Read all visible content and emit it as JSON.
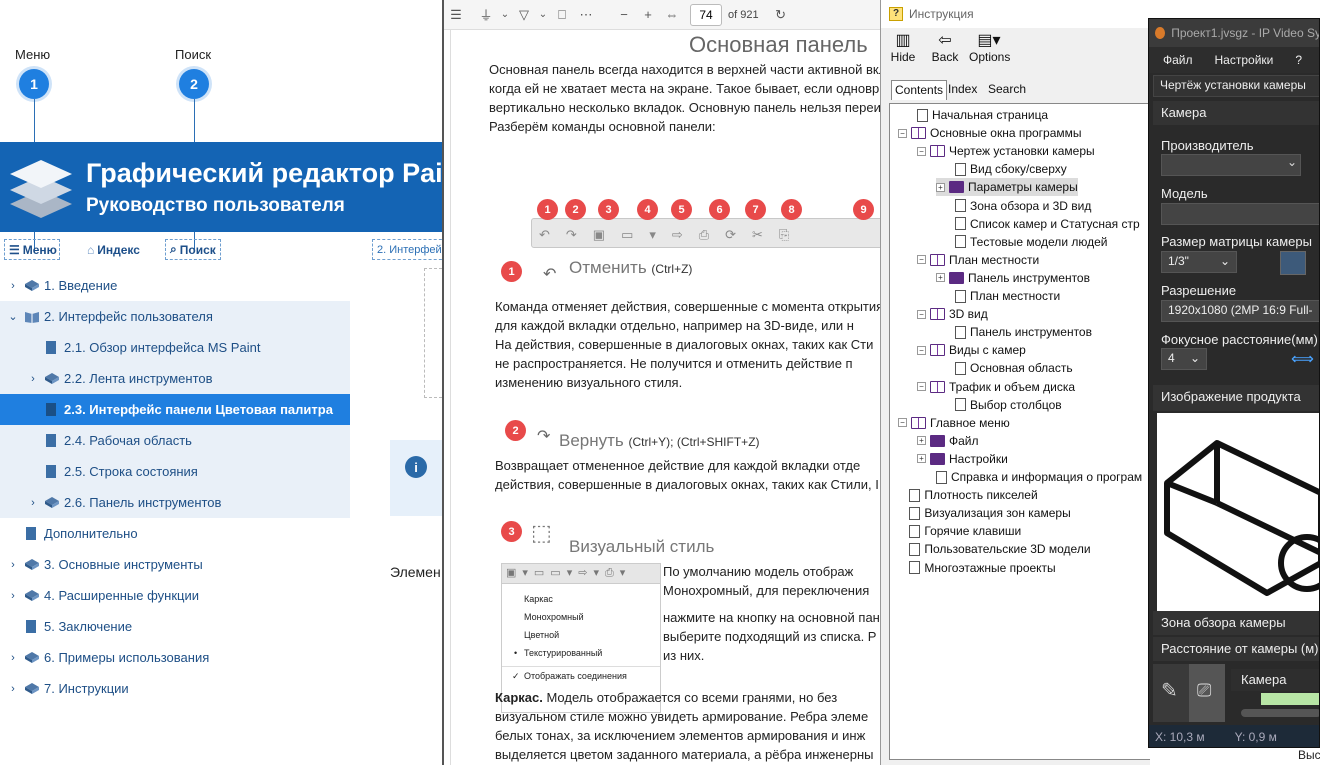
{
  "help_left": {
    "callout_menu_label": "Меню",
    "callout_menu_num": "1",
    "callout_search_label": "Поиск",
    "callout_search_num": "2",
    "banner_title": "Графический редактор Paint",
    "banner_subtitle": "Руководство пользователя",
    "toolbar": {
      "menu": "Меню",
      "index": "Индекс",
      "search": "Поиск",
      "breadcrumb": "2. Интерфей"
    },
    "tree": [
      {
        "label": "1. Введение",
        "level": 0,
        "arrow": "›",
        "icon": "book"
      },
      {
        "label": "2. Интерфейс пользователя",
        "level": 0,
        "arrow": "⌄",
        "icon": "book-open",
        "sub": true
      },
      {
        "label": "2.1. Обзор интерфейса MS Paint",
        "level": 1,
        "arrow": "",
        "icon": "page",
        "sub": true
      },
      {
        "label": "2.2. Лента инструментов",
        "level": 1,
        "arrow": "›",
        "icon": "book",
        "sub": true
      },
      {
        "label": "2.3. Интерфейс панели Цветовая палитра",
        "level": 1,
        "arrow": "",
        "icon": "page",
        "active": true
      },
      {
        "label": "2.4. Рабочая область",
        "level": 1,
        "arrow": "",
        "icon": "page",
        "sub": true
      },
      {
        "label": "2.5. Строка состояния",
        "level": 1,
        "arrow": "",
        "icon": "page",
        "sub": true
      },
      {
        "label": "2.6. Панель инструментов",
        "level": 1,
        "arrow": "›",
        "icon": "book",
        "sub": true
      },
      {
        "label": "Дополнительно",
        "level": 0,
        "arrow": "",
        "icon": "page"
      },
      {
        "label": "3. Основные инструменты",
        "level": 0,
        "arrow": "›",
        "icon": "book"
      },
      {
        "label": "4. Расширенные функции",
        "level": 0,
        "arrow": "›",
        "icon": "book"
      },
      {
        "label": "5. Заключение",
        "level": 0,
        "arrow": "",
        "icon": "page"
      },
      {
        "label": "6. Примеры использования",
        "level": 0,
        "arrow": "›",
        "icon": "book"
      },
      {
        "label": "7. Инструкции",
        "level": 0,
        "arrow": "›",
        "icon": "book"
      }
    ],
    "content_text": "Элемен"
  },
  "pdf": {
    "page_current": "74",
    "page_total": "of 921",
    "heading": "Основная панель",
    "intro": [
      "Основная панель всегда находится в верхней части активной вкл",
      "когда ей не хватает места на экране. Такое бывает, если одновр",
      "вертикально несколько вкладок. Основную панель нельзя переи",
      "Разберём команды основной панели:"
    ],
    "toolbar_badges": [
      "1",
      "2",
      "3",
      "4",
      "5",
      "6",
      "7",
      "8",
      "9"
    ],
    "sec1_num": "1",
    "sec1_title": "Отменить",
    "sec1_keys": "(Ctrl+Z)",
    "sec1_text": [
      "Команда отменяет действия, совершенные с момента открытия",
      "для каждой вкладки отдельно, например на 3D-виде, или н",
      "На действия, совершенные в диалоговых окнах, таких как Сти",
      "не распространяется. Не получится и отменить действие п",
      "изменению визуального стиля."
    ],
    "sec2_num": "2",
    "sec2_title": "Вернуть",
    "sec2_keys": "(Ctrl+Y); (Ctrl+SHIFT+Z)",
    "sec2_text": [
      "Возвращает отмененное действие для каждой вкладки отде",
      "действия, совершенные в диалоговых окнах, таких как Стили, I"
    ],
    "sec3_num": "3",
    "sec3_title": "Визуальный стиль",
    "sec3_text_a": [
      "По умолчанию модель отображ",
      "Монохромный, для переключения"
    ],
    "sec3_text_b": [
      "нажмите на кнопку на основной пан",
      "выберите подходящий из списка. Р",
      "из них."
    ],
    "menu_items": [
      "Каркас",
      "Монохромный",
      "Цветной",
      "Текстурированный",
      "Отображать соединения"
    ],
    "bottom_bold": "Каркас.",
    "bottom_text": [
      " Модель отображается со всеми гранями, но без",
      "визуальном стиле можно увидеть армирование. Ребра элеме",
      "белых тонах, за исключением элементов армирования и инж",
      "выделяется цветом заданного материала, а рёбра инженерны"
    ]
  },
  "instr": {
    "title": "Инструкция",
    "toolbar": {
      "hide": "Hide",
      "back": "Back",
      "options": "Options"
    },
    "tabs": [
      "Contents",
      "Index",
      "Search"
    ],
    "tree": [
      {
        "label": "Начальная страница",
        "indent": 1,
        "box": "",
        "icon": "page"
      },
      {
        "label": "Основные окна программы",
        "indent": 0,
        "box": "−",
        "icon": "book-open"
      },
      {
        "label": "Чертеж установки камеры",
        "indent": 1,
        "box": "−",
        "icon": "book-open"
      },
      {
        "label": "Вид сбоку/сверху",
        "indent": 3,
        "box": "",
        "icon": "page"
      },
      {
        "label": "Параметры камеры",
        "indent": 2,
        "box": "+",
        "icon": "book",
        "sel": true
      },
      {
        "label": "Зона обзора и 3D вид",
        "indent": 3,
        "box": "",
        "icon": "page"
      },
      {
        "label": "Список камер и Статусная стр",
        "indent": 3,
        "box": "",
        "icon": "page"
      },
      {
        "label": "Тестовые модели людей",
        "indent": 3,
        "box": "",
        "icon": "page"
      },
      {
        "label": "План местности",
        "indent": 1,
        "box": "−",
        "icon": "book-open"
      },
      {
        "label": "Панель инструментов",
        "indent": 2,
        "box": "+",
        "icon": "book"
      },
      {
        "label": "План местности",
        "indent": 3,
        "box": "",
        "icon": "page"
      },
      {
        "label": "3D вид",
        "indent": 1,
        "box": "−",
        "icon": "book-open"
      },
      {
        "label": "Панель инструментов",
        "indent": 3,
        "box": "",
        "icon": "page"
      },
      {
        "label": "Виды с камер",
        "indent": 1,
        "box": "−",
        "icon": "book-open"
      },
      {
        "label": "Основная область",
        "indent": 3,
        "box": "",
        "icon": "page"
      },
      {
        "label": "Трафик и объем диска",
        "indent": 1,
        "box": "−",
        "icon": "book-open"
      },
      {
        "label": "Выбор столбцов",
        "indent": 3,
        "box": "",
        "icon": "page"
      },
      {
        "label": "Главное меню",
        "indent": 0,
        "box": "−",
        "icon": "book-open"
      },
      {
        "label": "Файл",
        "indent": 1,
        "box": "+",
        "icon": "book"
      },
      {
        "label": "Настройки",
        "indent": 1,
        "box": "+",
        "icon": "book"
      },
      {
        "label": "Справка и информация о програм",
        "indent": 2,
        "box": "",
        "icon": "page"
      },
      {
        "label": "Плотность пикселей",
        "indent": 0.6,
        "box": "",
        "icon": "page"
      },
      {
        "label": "Визуализация зон камеры",
        "indent": 0.6,
        "box": "",
        "icon": "page"
      },
      {
        "label": "Горячие клавиши",
        "indent": 0.6,
        "box": "",
        "icon": "page"
      },
      {
        "label": "Пользовательские 3D модели",
        "indent": 0.6,
        "box": "",
        "icon": "page"
      },
      {
        "label": "Многоэтажные проекты",
        "indent": 0.6,
        "box": "",
        "icon": "page"
      }
    ]
  },
  "ipv": {
    "title": "Проект1.jvsgz - IP Video Sy",
    "menu": [
      "Файл",
      "Настройки",
      "?"
    ],
    "dropdown": "Чертёж установки камеры",
    "section_camera": "Камера",
    "manufacturer_label": "Производитель",
    "manufacturer_value": "",
    "model_label": "Модель",
    "model_value": "",
    "matrix_label": "Размер матрицы камеры",
    "matrix_value": "1/3\"",
    "resolution_label": "Разрешение",
    "resolution_value": "1920x1080 (2MP 16:9 Full-",
    "focal_label": "Фокусное расстояние(мм)",
    "focal_value": "4",
    "product_image_label": "Изображение продукта",
    "zone_label": "Зона обзора камеры",
    "distance_label": "Расстояние от камеры (м)",
    "bottom_tab": "Камера",
    "status_x": "X: 10,3 м",
    "status_y": "Y: 0,9 м"
  },
  "bottom_right": "Высот"
}
